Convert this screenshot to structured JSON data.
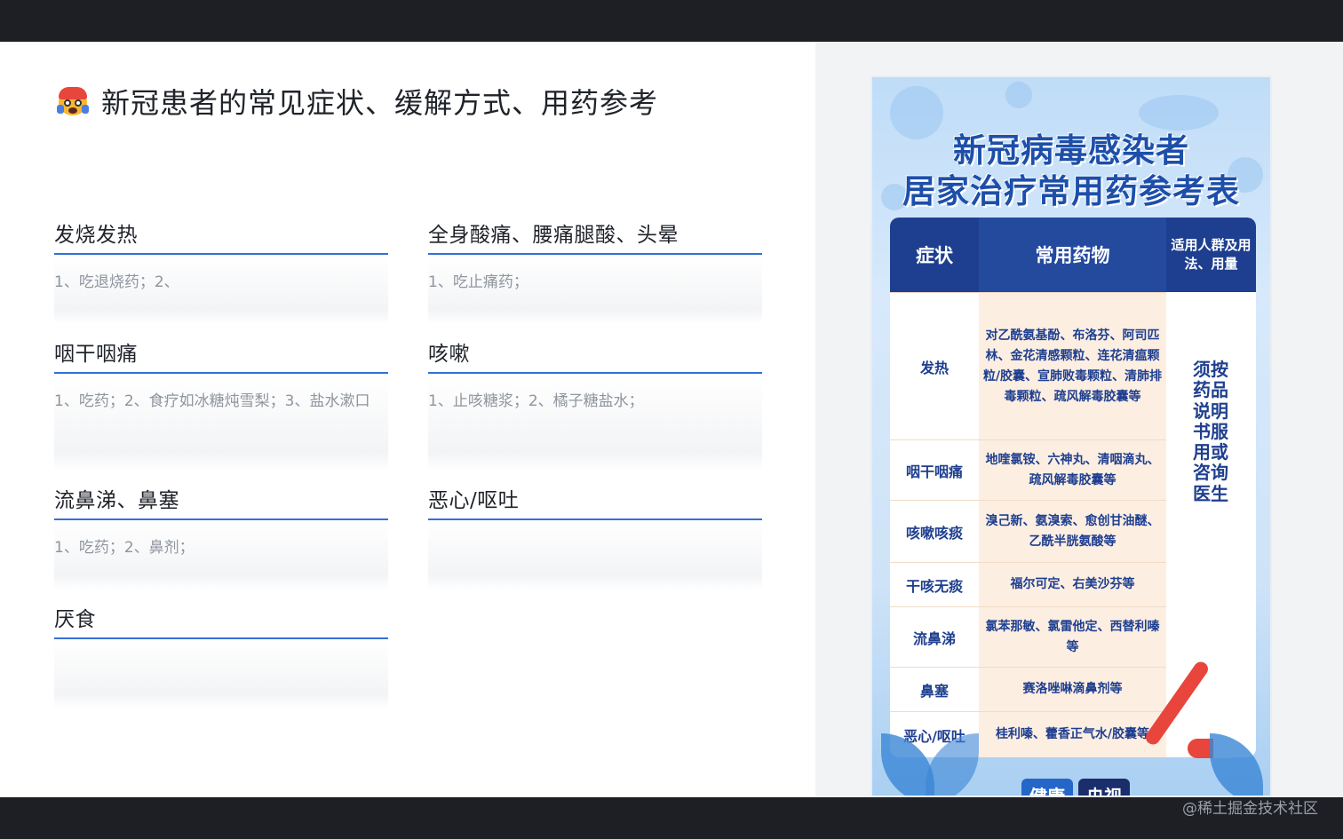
{
  "document": {
    "title": "新冠患者的常见症状、缓解方式、用药参考",
    "cards": [
      {
        "heading": "发烧发热",
        "content": "1、吃退烧药；2、"
      },
      {
        "heading": "全身酸痛、腰痛腿酸、头晕",
        "content": "1、吃止痛药；"
      },
      {
        "heading": "咽干咽痛",
        "content": "1、吃药；2、食疗如冰糖炖雪梨；3、盐水漱口"
      },
      {
        "heading": "咳嗽",
        "content": "1、止咳糖浆；2、橘子糖盐水；"
      },
      {
        "heading": "流鼻涕、鼻塞",
        "content": "1、吃药；2、鼻剂；"
      },
      {
        "heading": "恶心/呕吐",
        "content": ""
      },
      {
        "heading": "厌食",
        "content": ""
      }
    ]
  },
  "poster": {
    "title_line1": "新冠病毒感染者",
    "title_line2": "居家治疗常用药参考表",
    "headers": {
      "symptom": "症状",
      "medicine": "常用药物",
      "usage": "适用人群及用法、用量"
    },
    "rows": [
      {
        "symptom": "发热",
        "medicine": "对乙酰氨基酚、布洛芬、阿司匹林、金花清感颗粒、连花清瘟颗粒/胶囊、宣肺败毒颗粒、清肺排毒颗粒、疏风解毒胶囊等"
      },
      {
        "symptom": "咽干咽痛",
        "medicine": "地喹氯铵、六神丸、清咽滴丸、疏风解毒胶囊等"
      },
      {
        "symptom": "咳嗽咳痰",
        "medicine": "溴己新、氨溴索、愈创甘油醚、乙酰半胱氨酸等"
      },
      {
        "symptom": "干咳无痰",
        "medicine": "福尔可定、右美沙芬等"
      },
      {
        "symptom": "流鼻涕",
        "medicine": "氯苯那敏、氯雷他定、西替利嗪等"
      },
      {
        "symptom": "鼻塞",
        "medicine": "赛洛唑啉滴鼻剂等"
      },
      {
        "symptom": "恶心/呕吐",
        "medicine": "桂利嗪、藿香正气水/胶囊等"
      }
    ],
    "note": "须按药品说明书服用或咨询医生",
    "logo_left": "健康",
    "logo_right": "央视"
  },
  "watermark": "@稀土掘金技术社区",
  "colors": {
    "accent": "#3370d6",
    "poster_blue": "#1e3f8f",
    "poster_cream": "#fdeee2"
  }
}
